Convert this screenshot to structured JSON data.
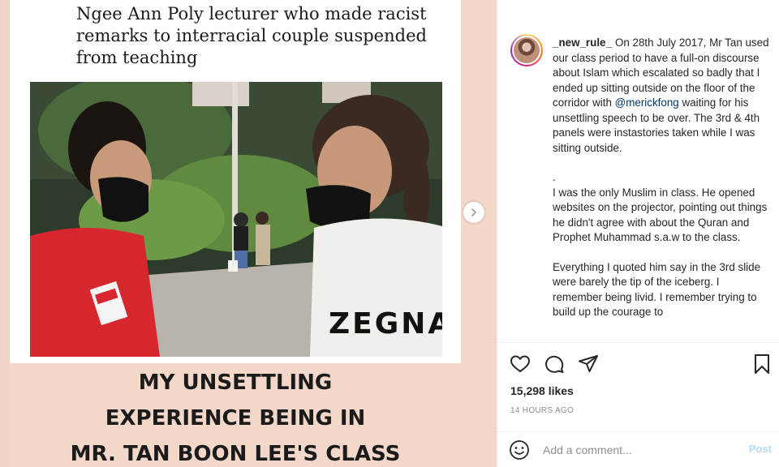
{
  "post_image": {
    "headline": "Ngee Ann Poly lecturer who made racist remarks to interracial couple suspended from teaching",
    "shirt_text": "ZEGNA",
    "caption_lines": [
      "MY UNSETTLING",
      "EXPERIENCE BEING IN",
      "MR. TAN BOON LEE'S CLASS"
    ]
  },
  "comment": {
    "username": "_new_rule_",
    "paragraph1_before_mention": "On 28th July 2017, Mr Tan used our class period to have a full-on discourse about Islam which escalated so badly that I ended up sitting outside on the floor of the corridor with ",
    "mention": "@merickfong",
    "paragraph1_after_mention": " waiting for his unsettling speech to be over. The 3rd & 4th panels were instastories taken while I was sitting outside.",
    "separator": ".",
    "paragraph2": "I was the only Muslim in class. He opened websites on the projector, pointing out things he didn't agree with about the Quran and Prophet Muhammad s.a.w to the class.",
    "paragraph3": "Everything I quoted him say in the 3rd slide were barely the tip of the iceberg. I remember being livid. I remember trying to build up the courage to"
  },
  "actions": {
    "likes": "15,298 likes",
    "timestamp": "14 HOURS AGO"
  },
  "add_comment": {
    "placeholder": "Add a comment...",
    "post_label": "Post"
  },
  "colors": {
    "media_background": "#f3d8c9",
    "mention": "#00376b",
    "post_button": "#b3dbff"
  }
}
